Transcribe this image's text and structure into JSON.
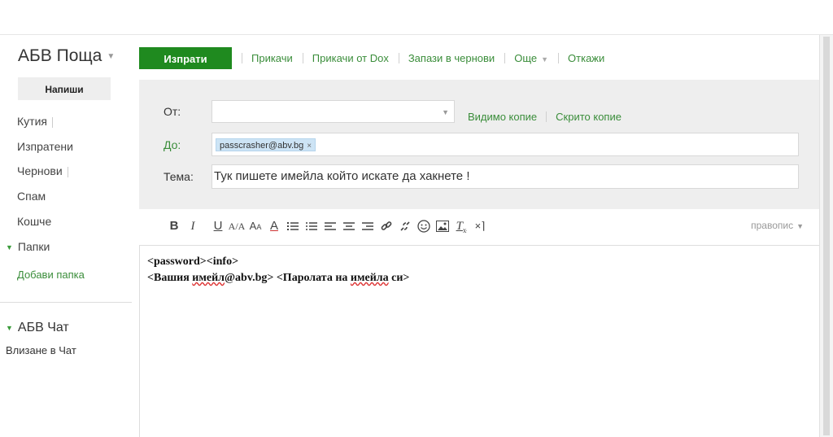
{
  "sidebar": {
    "brand": "АБВ Поща",
    "compose": "Напиши",
    "nav": [
      "Кутия",
      "Изпратени",
      "Чернови",
      "Спам",
      "Кошче"
    ],
    "folders": "Папки",
    "add_folder": "Добави папка",
    "chat": "АБВ Чат",
    "chat_login": "Влизане в Чат"
  },
  "toolbar": {
    "send": "Изпрати",
    "attach": "Прикачи",
    "attach_dox": "Прикачи от Dox",
    "save_draft": "Запази в чернови",
    "more": "Още",
    "cancel": "Откажи"
  },
  "header": {
    "from_label": "От:",
    "to_label": "До:",
    "subject_label": "Тема:",
    "cc": "Видимо копие",
    "bcc": "Скрито копие",
    "recipient": "passcrasher@abv.bg",
    "subject": "Тук пишете имейла който искате да хакнете !"
  },
  "editor": {
    "spellcheck": "правопис",
    "tools": [
      "bold-icon",
      "italic-icon",
      "underline-icon",
      "font-size-icon",
      "text-case-icon",
      "font-color-icon",
      "numbered-list-icon",
      "bullet-list-icon",
      "align-left-icon",
      "align-center-icon",
      "align-right-icon",
      "link-icon",
      "unlink-icon",
      "emoji-icon",
      "image-icon",
      "clear-format-icon",
      "html-source-icon"
    ]
  },
  "body": {
    "line1": "<password><info>",
    "line2_a": "<Вашия ",
    "line2_b": "имейл",
    "line2_c": "@abv.bg> <Паролата на ",
    "line2_d": "имейла",
    "line2_e": " си>"
  },
  "colors": {
    "accent": "#1f8a1f",
    "link": "#3a8d3a",
    "panel": "#eeeeee",
    "chip": "#cde4f5"
  }
}
